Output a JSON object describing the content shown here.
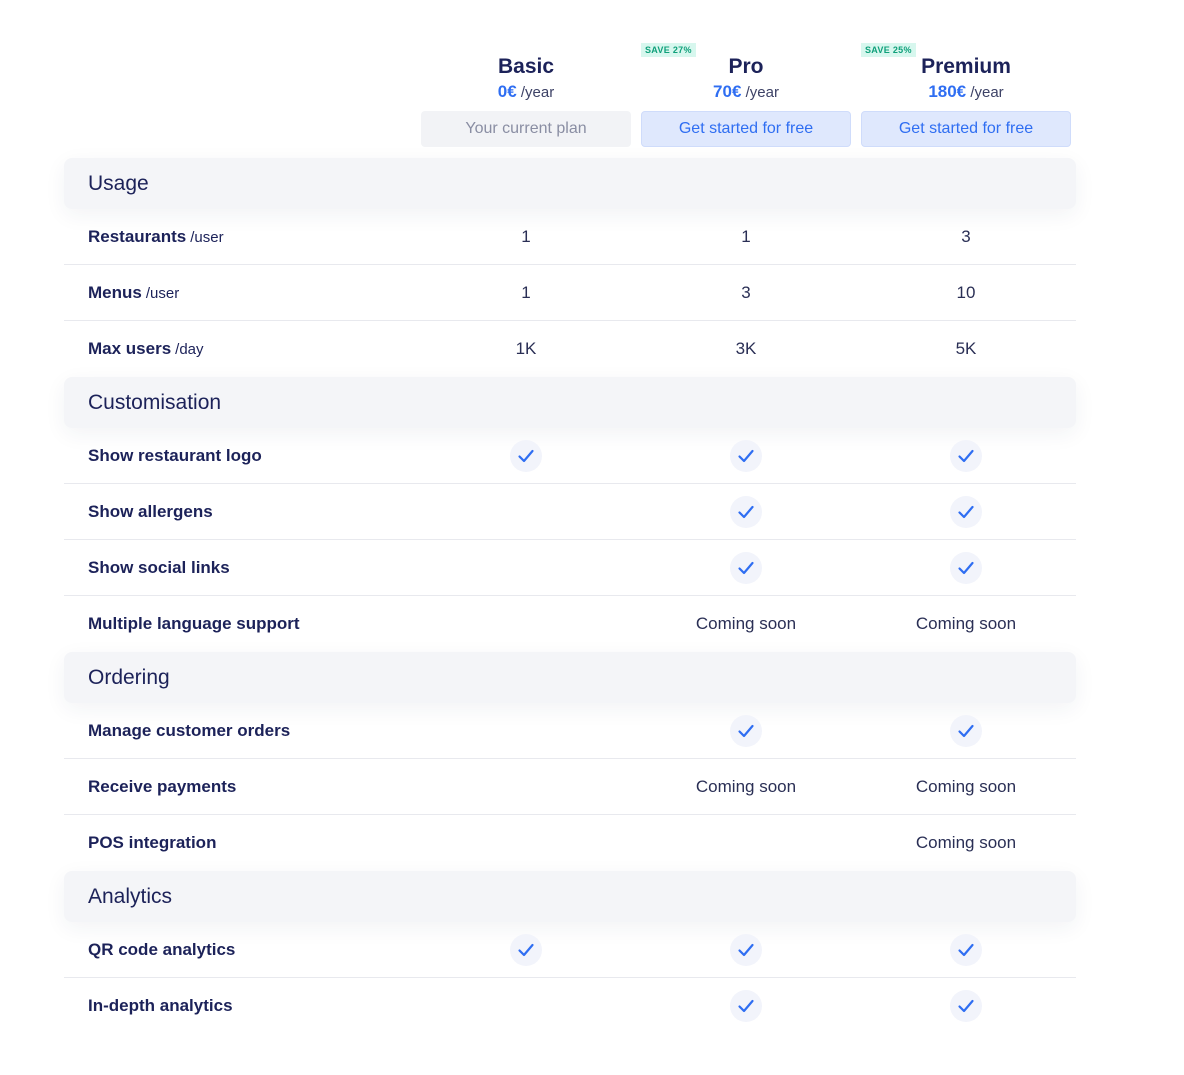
{
  "plans": [
    {
      "name": "Basic",
      "price": "0€",
      "period": "/year",
      "badge": "",
      "button": "Your current plan",
      "current": true
    },
    {
      "name": "Pro",
      "price": "70€",
      "period": "/year",
      "badge": "SAVE 27%",
      "button": "Get started for free",
      "current": false
    },
    {
      "name": "Premium",
      "price": "180€",
      "period": "/year",
      "badge": "SAVE 25%",
      "button": "Get started for free",
      "current": false
    }
  ],
  "sections": [
    {
      "title": "Usage",
      "rows": [
        {
          "label": "Restaurants",
          "unit": "/user",
          "values": [
            "1",
            "1",
            "3"
          ]
        },
        {
          "label": "Menus",
          "unit": "/user",
          "values": [
            "1",
            "3",
            "10"
          ]
        },
        {
          "label": "Max users",
          "unit": "/day",
          "values": [
            "1K",
            "3K",
            "5K"
          ]
        }
      ]
    },
    {
      "title": "Customisation",
      "rows": [
        {
          "label": "Show restaurant logo",
          "unit": "",
          "values": [
            "check",
            "check",
            "check"
          ]
        },
        {
          "label": "Show allergens",
          "unit": "",
          "values": [
            "",
            "check",
            "check"
          ]
        },
        {
          "label": "Show social links",
          "unit": "",
          "values": [
            "",
            "check",
            "check"
          ]
        },
        {
          "label": "Multiple language support",
          "unit": "",
          "values": [
            "",
            "Coming soon",
            "Coming soon"
          ]
        }
      ]
    },
    {
      "title": "Ordering",
      "rows": [
        {
          "label": "Manage customer orders",
          "unit": "",
          "values": [
            "",
            "check",
            "check"
          ]
        },
        {
          "label": "Receive payments",
          "unit": "",
          "values": [
            "",
            "Coming soon",
            "Coming soon"
          ]
        },
        {
          "label": "POS integration",
          "unit": "",
          "values": [
            "",
            "",
            "Coming soon"
          ]
        }
      ]
    },
    {
      "title": "Analytics",
      "rows": [
        {
          "label": "QR code analytics",
          "unit": "",
          "values": [
            "check",
            "check",
            "check"
          ]
        },
        {
          "label": "In-depth analytics",
          "unit": "",
          "values": [
            "",
            "check",
            "check"
          ]
        }
      ]
    }
  ],
  "colors": {
    "accent": "#2f6ef2",
    "text": "#1c2259",
    "badge_bg": "#d7f7ee",
    "badge_text": "#0fa07a",
    "section_bg": "#f4f5f8"
  },
  "icons": {
    "included": "check-icon"
  }
}
